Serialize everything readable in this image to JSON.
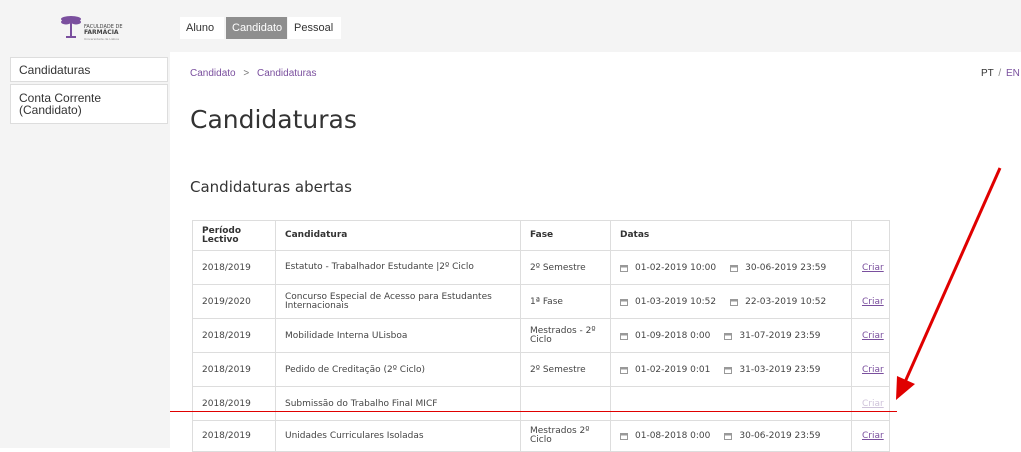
{
  "logo": {
    "text_top": "FACULDADE DE",
    "text_main": "FARMÁCIA",
    "text_sub": "Universidade de Lisboa"
  },
  "topnav": {
    "tabs": [
      {
        "label": "Aluno"
      },
      {
        "label": "Candidato",
        "active": true
      },
      {
        "label": "Pessoal"
      }
    ]
  },
  "sidebar": {
    "items": [
      {
        "label": "Candidaturas"
      },
      {
        "label_line1": "Conta Corrente",
        "label_line2": "(Candidato)"
      }
    ]
  },
  "breadcrumb": {
    "root": "Candidato",
    "separator": ">",
    "current": "Candidaturas"
  },
  "lang": {
    "pt": "PT",
    "separator": "/",
    "en": "EN"
  },
  "page_title": "Candidaturas",
  "section_title": "Candidaturas abertas",
  "table": {
    "headers": {
      "periodo_line1": "Período",
      "periodo_line2": "Lectivo",
      "candidatura": "Candidatura",
      "fase": "Fase",
      "datas": "Datas"
    },
    "rows": [
      {
        "periodo": "2018/2019",
        "candidatura": "Estatuto - Trabalhador Estudante |2º Ciclo",
        "candidatura_line2": "",
        "fase": "2º Semestre",
        "fase_line2": "",
        "start": "01-02-2019 10:00",
        "end": "30-06-2019 23:59",
        "action": "Criar"
      },
      {
        "periodo": "2019/2020",
        "candidatura": "Concurso Especial de Acesso para Estudantes",
        "candidatura_line2": "Internacionais",
        "fase": "1ª Fase",
        "fase_line2": "",
        "start": "01-03-2019 10:52",
        "end": "22-03-2019 10:52",
        "action": "Criar"
      },
      {
        "periodo": "2018/2019",
        "candidatura": "Mobilidade Interna ULisboa",
        "candidatura_line2": "",
        "fase": "Mestrados - 2º",
        "fase_line2": "Ciclo",
        "start": "01-09-2018 0:00",
        "end": "31-07-2019 23:59",
        "action": "Criar"
      },
      {
        "periodo": "2018/2019",
        "candidatura": "Pedido de Creditação (2º Ciclo)",
        "candidatura_line2": "",
        "fase": "2º Semestre",
        "fase_line2": "",
        "start": "01-02-2019 0:01",
        "end": "31-03-2019 23:59",
        "action": "Criar"
      },
      {
        "periodo": "2018/2019",
        "candidatura": "Submissão do Trabalho Final MICF",
        "candidatura_line2": "",
        "fase": "",
        "fase_line2": "",
        "start": "",
        "end": "",
        "action": "Criar",
        "disabled": true
      },
      {
        "periodo": "2018/2019",
        "candidatura": "Unidades Curriculares Isoladas",
        "candidatura_line2": "",
        "fase": "Mestrados 2º",
        "fase_line2": "Ciclo",
        "start": "01-08-2018 0:00",
        "end": "30-06-2019 23:59",
        "action": "Criar"
      }
    ]
  },
  "icons": {
    "calendar": "calendar-icon",
    "logo": "palm-tree-logo"
  },
  "colors": {
    "accent": "#7a4f9e",
    "active_tab": "#8e8e8e",
    "annotation_red": "#e00000",
    "background_gray": "#f4f4f4"
  }
}
